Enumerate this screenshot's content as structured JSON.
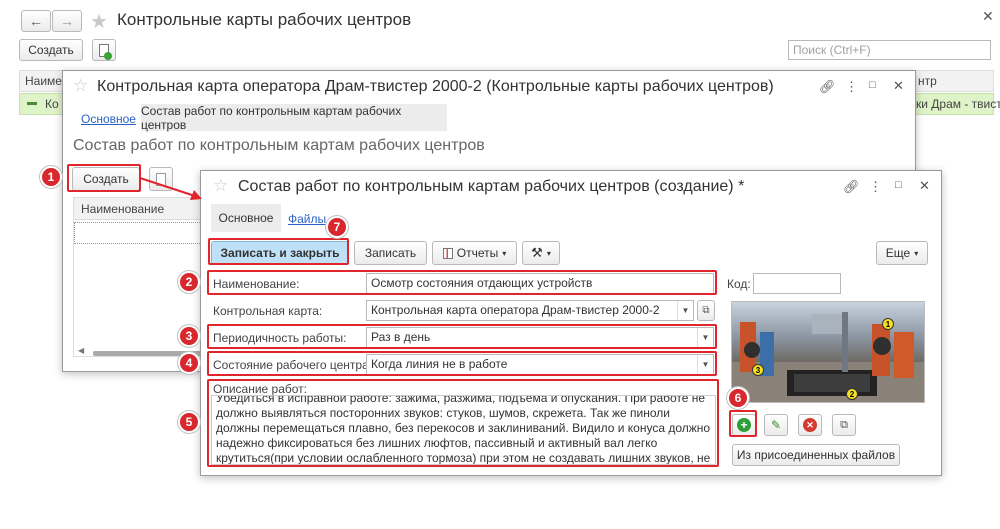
{
  "app": {
    "title": "Контрольные карты рабочих центров",
    "create_label": "Создать",
    "search_placeholder": "Поиск (Ctrl+F)",
    "col_name": "Наименов",
    "col_right": "нтр",
    "row_left": "Ко",
    "row_right": "ки Драм - твист"
  },
  "win1": {
    "title": "Контрольная карта оператора Драм-твистер 2000-2 (Контрольные карты рабочих центров)",
    "tab_main": "Основное",
    "tab_active": "Состав работ по контрольным картам рабочих центров",
    "section_title": "Состав работ по контрольным картам рабочих центров",
    "create_label": "Создать",
    "col_name": "Наименование"
  },
  "win2": {
    "title": "Состав работ по контрольным картам рабочих центров (создание) *",
    "tab_main": "Основное",
    "tab_files": "Файлы",
    "save_close_label": "Записать и закрыть",
    "save_label": "Записать",
    "reports_label": "Отчеты",
    "more_label": "Еще",
    "name_label": "Наименование:",
    "name_value": "Осмотр состояния отдающих устройств",
    "code_label": "Код:",
    "code_value": "",
    "card_label": "Контрольная карта:",
    "card_value": "Контрольная карта оператора Драм-твистер 2000-2",
    "period_label": "Периодичность работы:",
    "period_value": "Раз в день",
    "state_label": "Состояние рабочего центра:",
    "state_value": "Когда линия не в работе",
    "desc_label": "Описание работ:",
    "desc_value": "Убедиться в исправной работе: зажима, разжима, подъема и опускания. При работе не должно выявляться посторонних звуков: стуков, шумов, скрежета. Так же пиноли должны перемещаться плавно, без перекосов и заклиниваний.  Видило и конуса должно надежно фиксироваться без лишних люфтов, пассивный  и активный вал легко крутиться(при условии ослабленного тормоза) при этом не создавать лишних звуков, не заклинивать.",
    "attached_label": "Из присоединенных файлов"
  },
  "photo_markers": [
    "1",
    "2",
    "3"
  ],
  "badges": [
    "1",
    "2",
    "3",
    "4",
    "5",
    "6",
    "7"
  ],
  "colors": {
    "accent_red": "#e2242b",
    "save_close_bg": "#bfe0f7",
    "selected_row": "#dff3c9"
  }
}
